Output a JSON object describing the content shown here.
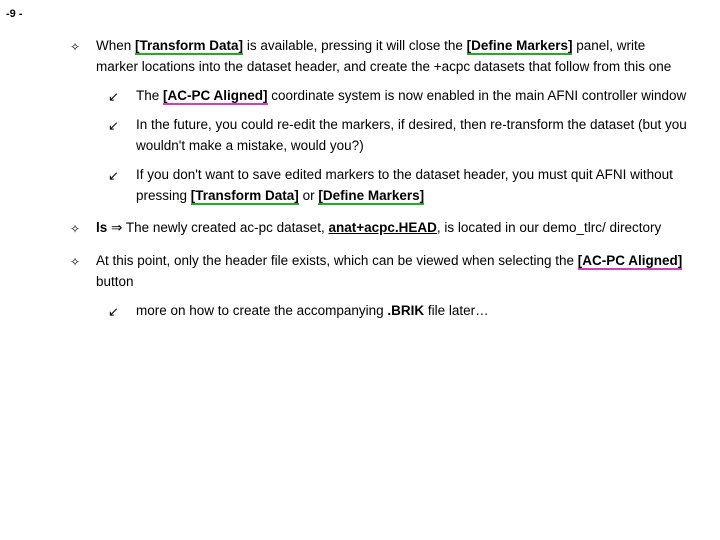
{
  "page_number": "-9 -",
  "p1": {
    "a": "When ",
    "btn1": "[Transform Data]",
    "b": " is available, pressing it will close the ",
    "btn2": "[Define Markers]",
    "c": " panel, write marker locations into the dataset header, and create the +acpc datasets that follow from this one"
  },
  "s1": {
    "a": "The ",
    "btn": "[AC-PC Aligned]",
    "b": " coordinate system is now enabled in the main AFNI controller window"
  },
  "s2": "In the future, you could re-edit the markers, if desired, then re-transform the dataset (but you wouldn't make a mistake, would you?)",
  "s3": {
    "a": "If you don't want to save edited markers to the dataset header, you must quit AFNI without pressing ",
    "btn1": "[Transform Data]",
    "mid": " or ",
    "btn2": "[Define Markers]"
  },
  "p2": {
    "a": "ls ",
    "arrow": "⇒",
    "b": " The newly created ac-pc dataset, ",
    "file": "anat+acpc.HEAD",
    "c": ", is located in our demo_tlrc/ directory"
  },
  "p3": {
    "a": "At this point, only the header file exists, which can be viewed when selecting the ",
    "btn": "[AC-PC Aligned]",
    "b": " button"
  },
  "s4": {
    "a": "more on how to create the accompanying ",
    "brik": ".BRIK",
    "b": " file later…"
  },
  "bullets": {
    "diamond": "✧",
    "arrow": "↙"
  }
}
